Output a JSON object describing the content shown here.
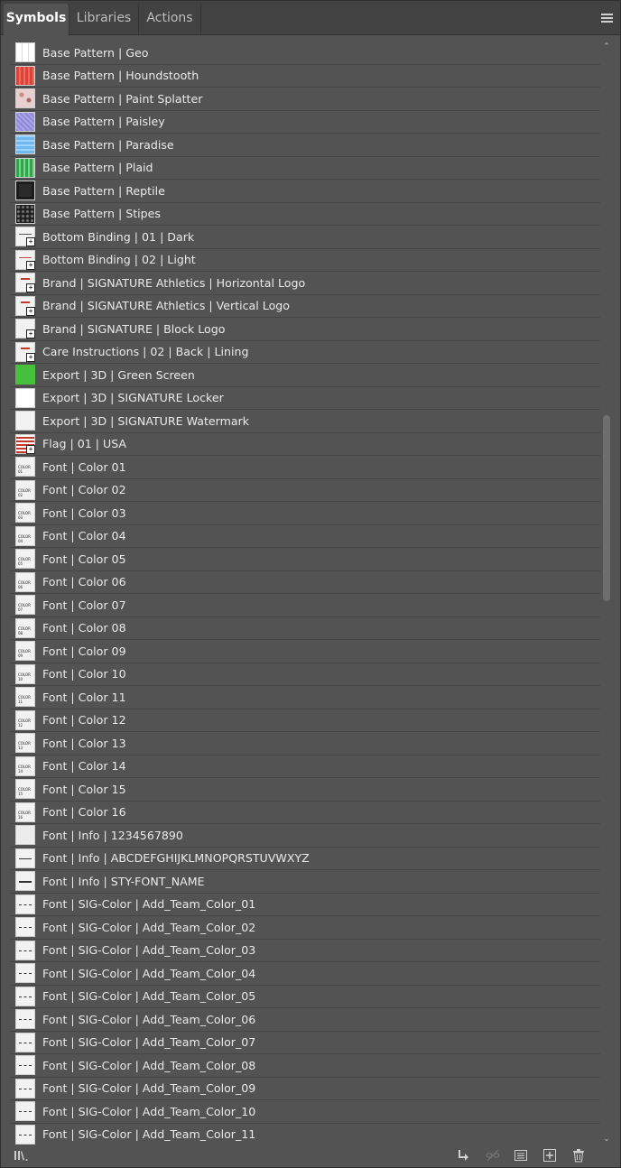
{
  "tabs": [
    {
      "label": "Symbols",
      "active": true
    },
    {
      "label": "Libraries",
      "active": false
    },
    {
      "label": "Actions",
      "active": false
    }
  ],
  "symbols": [
    {
      "label": "Base Pattern | Geo",
      "thumb": "pattern-geo"
    },
    {
      "label": "Base Pattern | Houndstooth",
      "thumb": "pattern-red"
    },
    {
      "label": "Base Pattern | Paint Splatter",
      "thumb": "pattern-splatter"
    },
    {
      "label": "Base Pattern | Paisley",
      "thumb": "pattern-paisley"
    },
    {
      "label": "Base Pattern | Paradise",
      "thumb": "pattern-paradise"
    },
    {
      "label": "Base Pattern | Plaid",
      "thumb": "pattern-plaid"
    },
    {
      "label": "Base Pattern | Reptile",
      "thumb": "pattern-reptile"
    },
    {
      "label": "Base Pattern | Stipes",
      "thumb": "pattern-stipes"
    },
    {
      "label": "Bottom Binding | 01 | Dark",
      "thumb": "binding-dark",
      "badge": true
    },
    {
      "label": "Bottom Binding | 02 | Light",
      "thumb": "binding-light",
      "badge": true
    },
    {
      "label": "Brand | SIGNATURE Athletics | Horizontal Logo",
      "thumb": "logo-h",
      "badge": true
    },
    {
      "label": "Brand | SIGNATURE Athletics | Vertical Logo",
      "thumb": "logo-v",
      "badge": true
    },
    {
      "label": "Brand | SIGNATURE | Block Logo",
      "thumb": "blank",
      "badge": true
    },
    {
      "label": "Care Instructions | 02 | Back | Lining",
      "thumb": "care",
      "badge": true
    },
    {
      "label": "Export | 3D | Green Screen",
      "thumb": "green"
    },
    {
      "label": "Export | 3D | SIGNATURE Locker",
      "thumb": "white"
    },
    {
      "label": "Export | 3D | SIGNATURE Watermark",
      "thumb": "blank"
    },
    {
      "label": "Flag | 01 | USA",
      "thumb": "flag",
      "badge": true
    },
    {
      "label": "Font | Color 01",
      "thumb": "color",
      "mini": "COLOR 01"
    },
    {
      "label": "Font | Color 02",
      "thumb": "color",
      "mini": "COLOR 02"
    },
    {
      "label": "Font | Color 03",
      "thumb": "color",
      "mini": "COLOR 03"
    },
    {
      "label": "Font | Color 04",
      "thumb": "color",
      "mini": "COLOR 04"
    },
    {
      "label": "Font | Color 05",
      "thumb": "color",
      "mini": "COLOR 05"
    },
    {
      "label": "Font | Color 06",
      "thumb": "color",
      "mini": "COLOR 06"
    },
    {
      "label": "Font | Color 07",
      "thumb": "color",
      "mini": "COLOR 07"
    },
    {
      "label": "Font | Color 08",
      "thumb": "color",
      "mini": "COLOR 08"
    },
    {
      "label": "Font | Color 09",
      "thumb": "color",
      "mini": "COLOR 09"
    },
    {
      "label": "Font | Color 10",
      "thumb": "color",
      "mini": "COLOR 10"
    },
    {
      "label": "Font | Color 11",
      "thumb": "color",
      "mini": "COLOR 11"
    },
    {
      "label": "Font | Color 12",
      "thumb": "color",
      "mini": "COLOR 12"
    },
    {
      "label": "Font | Color 13",
      "thumb": "color",
      "mini": "COLOR 13"
    },
    {
      "label": "Font | Color 14",
      "thumb": "color",
      "mini": "COLOR 14"
    },
    {
      "label": "Font | Color 15",
      "thumb": "color",
      "mini": "COLOR 15"
    },
    {
      "label": "Font | Color 16",
      "thumb": "color",
      "mini": "COLOR 16"
    },
    {
      "label": "Font | Info | 1234567890",
      "thumb": "faint"
    },
    {
      "label": "Font | Info | ABCDEFGHIJKLMNOPQRSTUVWXYZ",
      "thumb": "line"
    },
    {
      "label": "Font | Info | STY-FONT_NAME",
      "thumb": "line-bold"
    },
    {
      "label": "Font | SIG-Color | Add_Team_Color_01",
      "thumb": "dash"
    },
    {
      "label": "Font | SIG-Color | Add_Team_Color_02",
      "thumb": "dash"
    },
    {
      "label": "Font | SIG-Color | Add_Team_Color_03",
      "thumb": "dash"
    },
    {
      "label": "Font | SIG-Color | Add_Team_Color_04",
      "thumb": "dash"
    },
    {
      "label": "Font | SIG-Color | Add_Team_Color_05",
      "thumb": "dash"
    },
    {
      "label": "Font | SIG-Color | Add_Team_Color_06",
      "thumb": "dash"
    },
    {
      "label": "Font | SIG-Color | Add_Team_Color_07",
      "thumb": "dash"
    },
    {
      "label": "Font | SIG-Color | Add_Team_Color_08",
      "thumb": "dash"
    },
    {
      "label": "Font | SIG-Color | Add_Team_Color_09",
      "thumb": "dash"
    },
    {
      "label": "Font | SIG-Color | Add_Team_Color_10",
      "thumb": "dash"
    },
    {
      "label": "Font | SIG-Color | Add_Team_Color_11",
      "thumb": "dash"
    }
  ],
  "footer": {
    "icons": [
      "symbol-libraries-menu-icon",
      "place-symbol-instance-icon",
      "break-link-icon",
      "symbol-options-icon",
      "new-symbol-icon",
      "delete-symbol-icon"
    ]
  },
  "colors": {
    "panel_bg": "#535353",
    "tabbar_bg": "#424242",
    "text": "#eaeaea"
  }
}
